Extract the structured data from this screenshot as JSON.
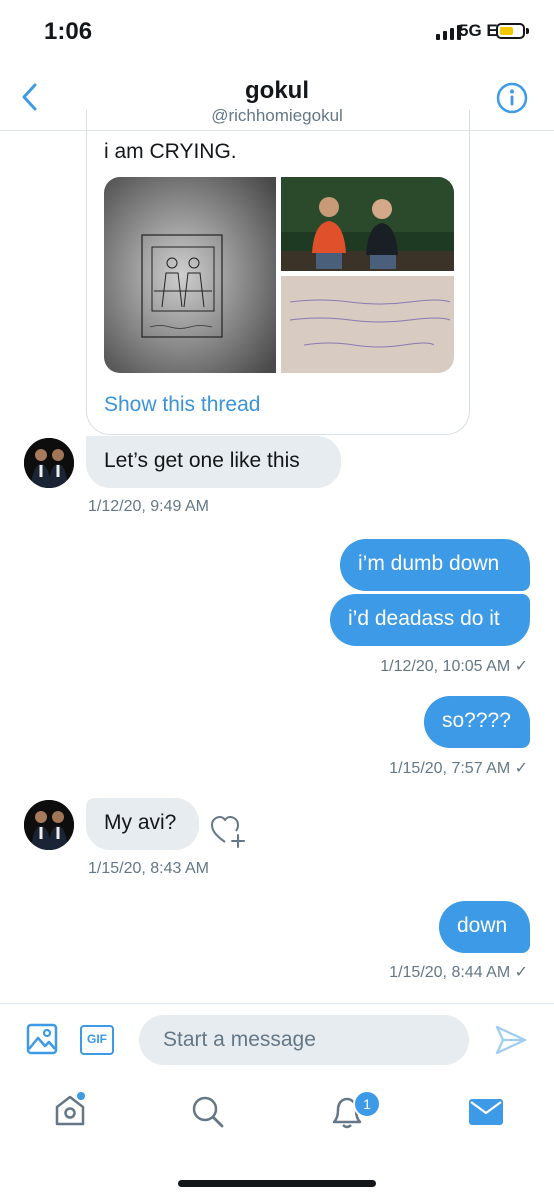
{
  "status_bar": {
    "time": "1:06",
    "network": "5G E"
  },
  "header": {
    "name": "gokul",
    "handle": "@richhomiegokul"
  },
  "quoted_card": {
    "text": "i am CRYING.",
    "show_thread": "Show this thread"
  },
  "messages": [
    {
      "text": "Let’s get one like this",
      "timestamp": "1/12/20, 9:49 AM"
    },
    {
      "text": "i’m dumb down"
    },
    {
      "text": "i’d deadass do it",
      "timestamp": "1/12/20, 10:05 AM ✓"
    },
    {
      "text": "so????",
      "timestamp": "1/15/20, 7:57 AM ✓"
    },
    {
      "text": "My avi?",
      "timestamp": "1/15/20, 8:43 AM"
    },
    {
      "text": "down",
      "timestamp": "1/15/20, 8:44 AM ✓"
    }
  ],
  "composer": {
    "placeholder": "Start a message",
    "gif_label": "GIF"
  },
  "tab_bar": {
    "notification_count": "1"
  },
  "colors": {
    "accent": "#3c9ae6",
    "incoming_bubble": "#e7ecf0",
    "secondary_text": "#657786"
  },
  "icons": [
    "back-chevron-icon",
    "info-icon",
    "like-add-icon",
    "image-icon",
    "gif-icon",
    "send-icon",
    "home-icon",
    "search-icon",
    "bell-icon",
    "mail-icon"
  ]
}
